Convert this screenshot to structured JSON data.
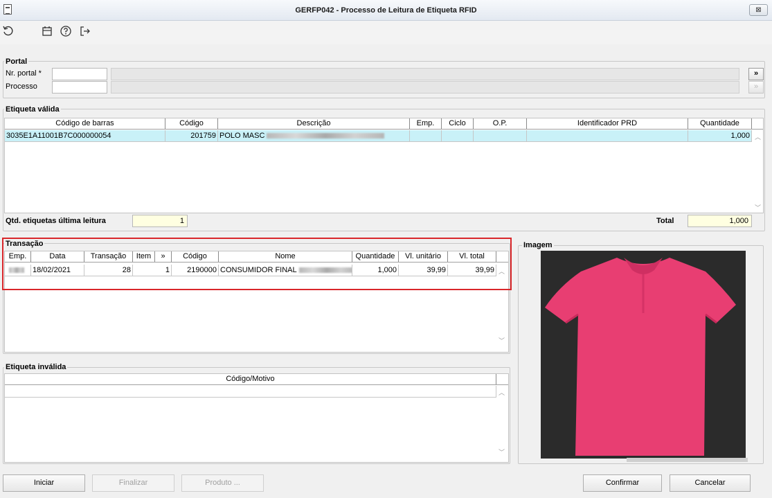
{
  "window": {
    "title": "GERFP042 - Processo de Leitura de Etiqueta RFID",
    "close_label": "⊠"
  },
  "toolbar": {
    "icons": [
      "refresh-icon",
      "calendar-icon",
      "help-icon",
      "exit-icon"
    ]
  },
  "portal": {
    "group_label": "Portal",
    "nr_portal_label": "Nr. portal *",
    "processo_label": "Processo",
    "nr_portal_value": "",
    "processo_value": "",
    "forward_label": "»",
    "secondary_label": "»"
  },
  "etiqueta_valida": {
    "group_label": "Etiqueta válida",
    "columns": [
      "Código de barras",
      "Código",
      "Descrição",
      "Emp.",
      "Ciclo",
      "O.P.",
      "Identificador PRD",
      "Quantidade"
    ],
    "rows": [
      {
        "codigo_barras": "3035E1A11001B7C000000054",
        "codigo": "201759",
        "descricao": "POLO MASC",
        "emp": "",
        "ciclo": "",
        "op": "",
        "identificador": "",
        "quantidade": "1,000"
      }
    ],
    "qtd_label": "Qtd. etiquetas última leitura",
    "qtd_value": "1",
    "total_label": "Total",
    "total_value": "1,000"
  },
  "transacao": {
    "group_label": "Transação",
    "columns": [
      "Emp.",
      "Data",
      "Transação",
      "Item",
      "»",
      "Código",
      "Nome",
      "Quantidade",
      "Vl. unitário",
      "Vl. total"
    ],
    "rows": [
      {
        "emp": "",
        "data": "18/02/2021",
        "transacao": "28",
        "item": "1",
        "codigo": "2190000",
        "nome": "CONSUMIDOR FINAL",
        "quantidade": "1,000",
        "vl_unitario": "39,99",
        "vl_total": "39,99"
      }
    ]
  },
  "etiqueta_invalida": {
    "group_label": "Etiqueta inválida",
    "columns": [
      "Código/Motivo"
    ]
  },
  "imagem": {
    "group_label": "Imagem",
    "shirt_color": "#e83e72"
  },
  "buttons": {
    "iniciar": "Iniciar",
    "finalizar": "Finalizar",
    "produto": "Produto ...",
    "confirmar": "Confirmar",
    "cancelar": "Cancelar"
  },
  "colors": {
    "highlight_row": "#c9f1f8",
    "red_frame": "#d9262a",
    "yellow_field": "#ffffe1"
  }
}
